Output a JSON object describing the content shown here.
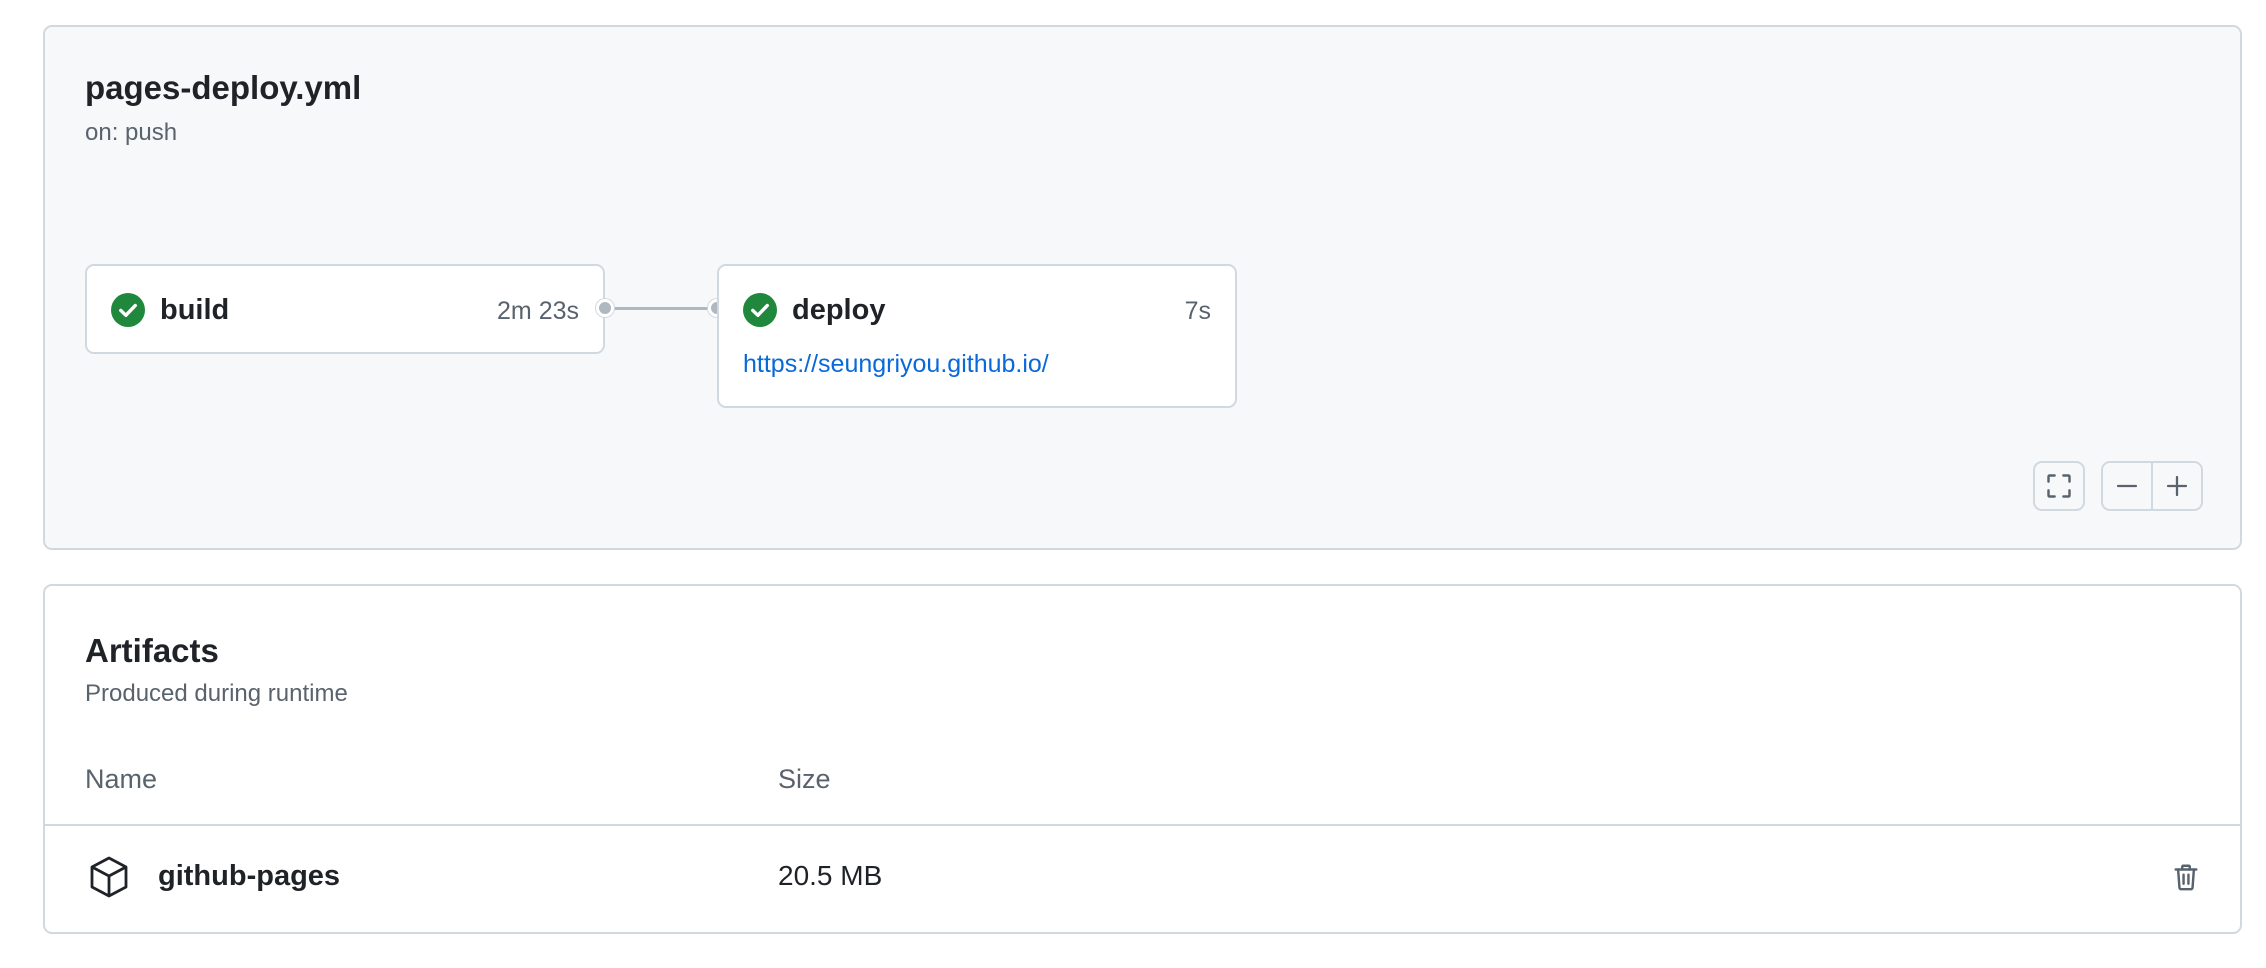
{
  "workflow": {
    "title": "pages-deploy.yml",
    "trigger": "on: push"
  },
  "jobs": [
    {
      "name": "build",
      "status": "success",
      "duration": "2m 23s",
      "icon": "check-circle-fill-icon"
    },
    {
      "name": "deploy",
      "status": "success",
      "duration": "7s",
      "url": "https://seungriyou.github.io/",
      "icon": "check-circle-fill-icon"
    }
  ],
  "graph_controls": {
    "fullscreen_icon": "screen-full-icon",
    "zoom_out_icon": "dash-icon",
    "zoom_in_icon": "plus-icon"
  },
  "artifacts": {
    "title": "Artifacts",
    "subtitle": "Produced during runtime",
    "columns": [
      "Name",
      "Size"
    ],
    "rows": [
      {
        "name": "github-pages",
        "size": "20.5 MB",
        "icon": "package-icon",
        "action_icon": "trash-icon"
      }
    ]
  },
  "colors": {
    "success": "#1f883d",
    "link": "#0969da",
    "border": "#d1d9e0",
    "panel_bg": "#f6f8fa",
    "muted_text": "#59636e"
  }
}
